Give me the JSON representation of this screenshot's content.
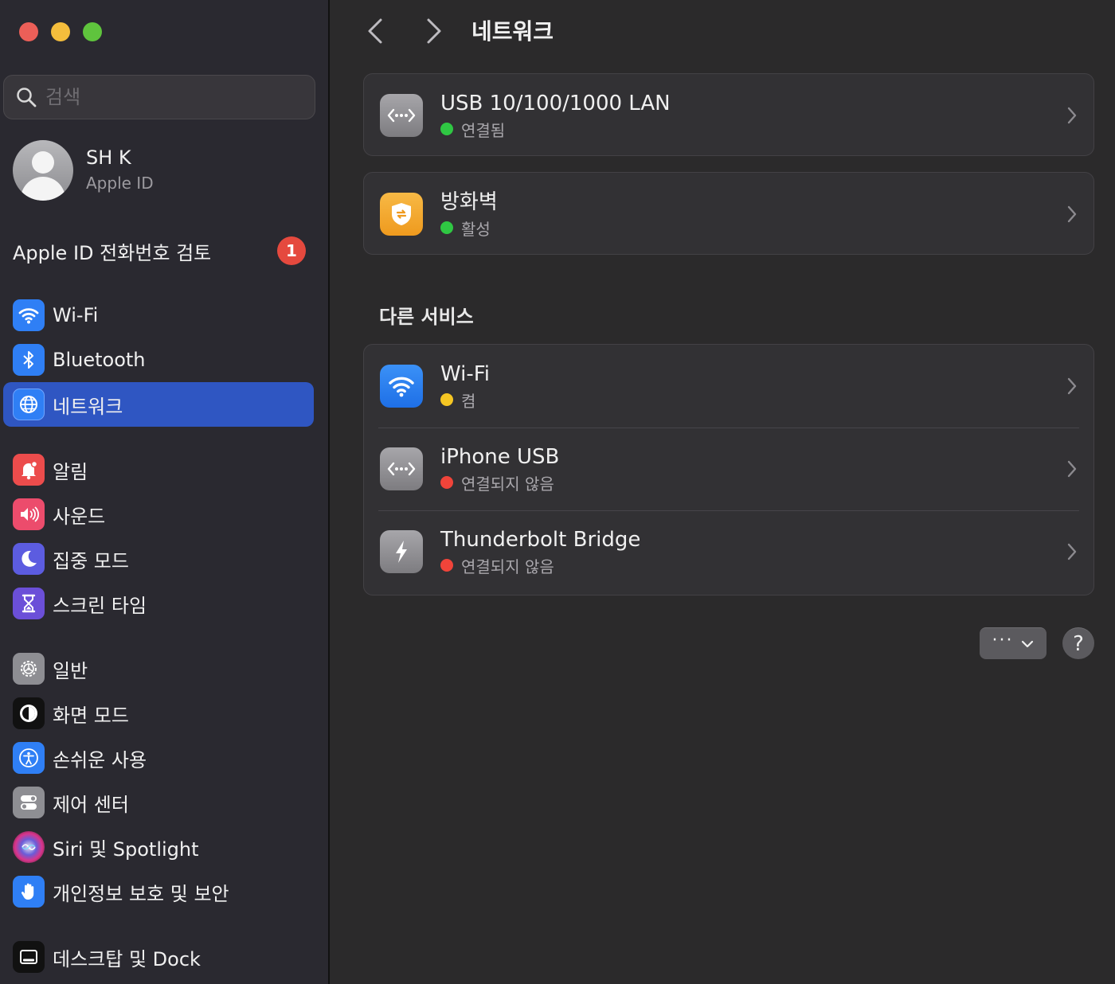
{
  "sidebar": {
    "search": {
      "placeholder": "검색"
    },
    "profile": {
      "name": "SH K",
      "subtitle": "Apple ID"
    },
    "review": {
      "label": "Apple ID 전화번호 검토",
      "badge": "1"
    },
    "groups": [
      [
        {
          "label": "Wi-Fi",
          "icon": "wifi-icon",
          "color": "#2f7ff5"
        },
        {
          "label": "Bluetooth",
          "icon": "bluetooth-icon",
          "color": "#2f7ff5"
        },
        {
          "label": "네트워크",
          "icon": "globe-icon",
          "color": "#2f7ff5",
          "active": true
        }
      ],
      [
        {
          "label": "알림",
          "icon": "bell-icon",
          "color": "#ec4c4c"
        },
        {
          "label": "사운드",
          "icon": "speaker-icon",
          "color": "#ec4c6c"
        },
        {
          "label": "집중 모드",
          "icon": "moon-icon",
          "color": "#5c5ce0"
        },
        {
          "label": "스크린 타임",
          "icon": "hourglass-icon",
          "color": "#6b4fd8"
        }
      ],
      [
        {
          "label": "일반",
          "icon": "gear-icon",
          "color": "#8e8e93"
        },
        {
          "label": "화면 모드",
          "icon": "appearance-icon",
          "color": "#111111"
        },
        {
          "label": "손쉬운 사용",
          "icon": "accessibility-icon",
          "color": "#2f7ff5"
        },
        {
          "label": "제어 센터",
          "icon": "toggles-icon",
          "color": "#8e8e93"
        },
        {
          "label": "Siri 및 Spotlight",
          "icon": "siri-icon",
          "color": "#222222"
        },
        {
          "label": "개인정보 보호 및 보안",
          "icon": "hand-icon",
          "color": "#2f7ff5"
        }
      ],
      [
        {
          "label": "데스크탑 및 Dock",
          "icon": "dock-icon",
          "color": "#111111"
        }
      ]
    ]
  },
  "toolbar": {
    "title": "네트워크"
  },
  "connections": [
    {
      "title": "USB 10/100/1000 LAN",
      "status": "연결됨",
      "status_color": "green",
      "icon": "ethernet-icon"
    },
    {
      "title": "방화벽",
      "status": "활성",
      "status_color": "green",
      "icon": "firewall-icon"
    }
  ],
  "other_services": {
    "title": "다른 서비스",
    "items": [
      {
        "title": "Wi-Fi",
        "status": "켬",
        "status_color": "yellow",
        "icon": "wifi-icon"
      },
      {
        "title": "iPhone USB",
        "status": "연결되지 않음",
        "status_color": "red",
        "icon": "ethernet-icon"
      },
      {
        "title": "Thunderbolt Bridge",
        "status": "연결되지 않음",
        "status_color": "red",
        "icon": "thunderbolt-icon"
      }
    ]
  },
  "actions": {
    "more": "···",
    "help": "?"
  }
}
